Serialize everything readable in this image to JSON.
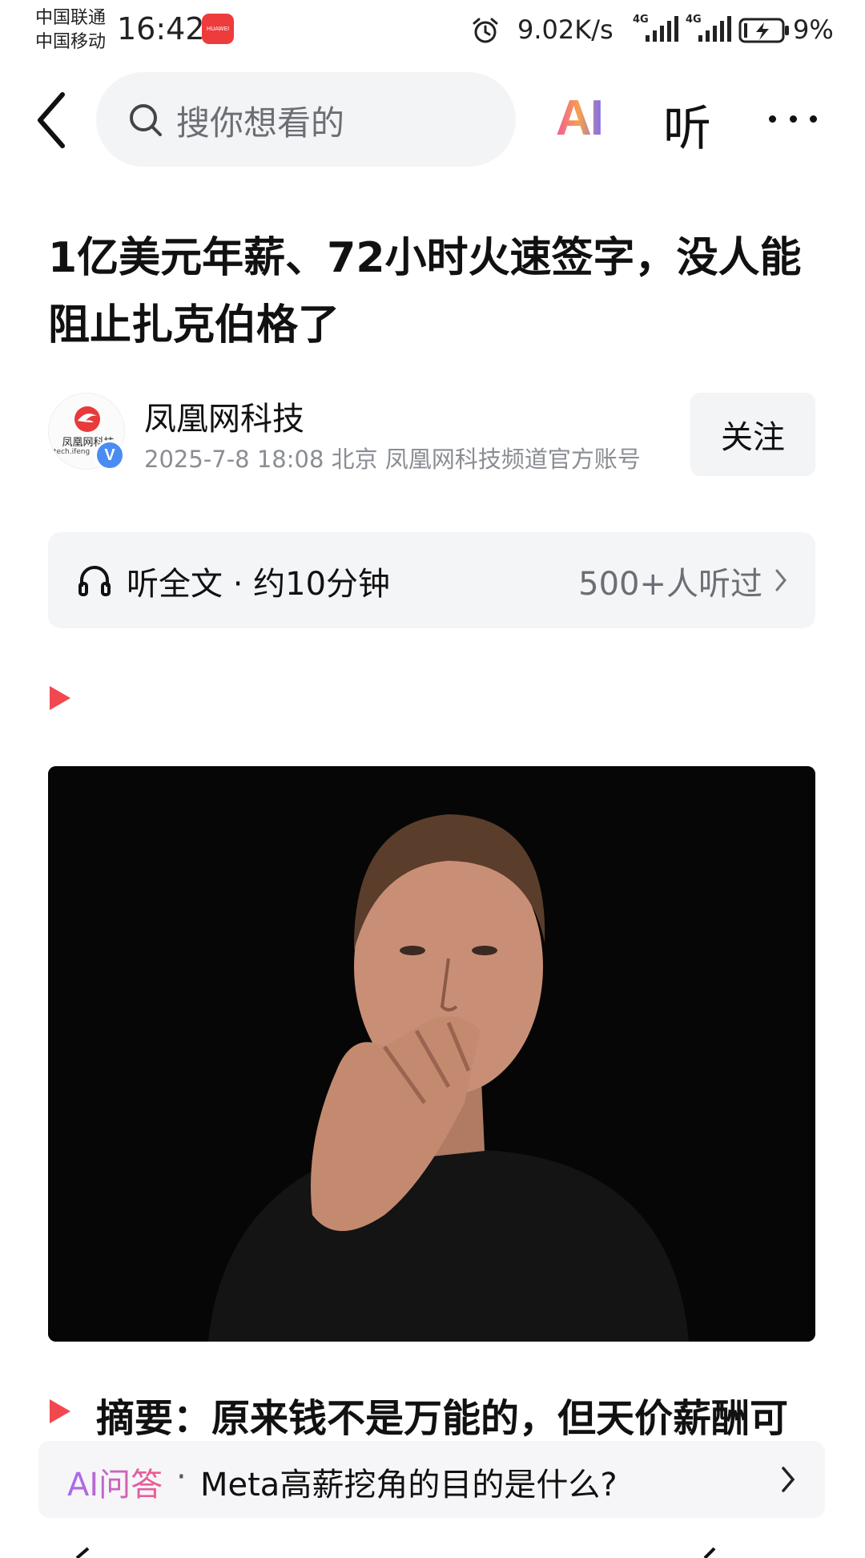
{
  "status_bar": {
    "carrier_1": "中国联通",
    "carrier_2": "中国移动",
    "time": "16:42",
    "app_badge": "HUAWEI",
    "net_speed": "9.02K/s",
    "signal_1_tag": "4G",
    "signal_2_tag": "4G",
    "battery": "9%"
  },
  "nav": {
    "search_placeholder": "搜你想看的",
    "ai_label": "AI",
    "listen_label": "听"
  },
  "article": {
    "title": "1亿美元年薪、72小时火速签字，没人能阻止扎克伯格了",
    "author": {
      "name": "凤凰网科技",
      "logo_text": "凤凰网科技",
      "logo_sub": "tech.ifeng",
      "verified_mark": "V",
      "meta": "2025-7-8  18:08  北京  凤凰网科技频道官方账号"
    },
    "follow_label": "关注"
  },
  "listen_bar": {
    "full_text_label": "听全文 · 约10分钟",
    "listener_count": "500+人听过"
  },
  "summary": {
    "text": "摘要：原来钱不是万能的，但天价薪酬可"
  },
  "ai_qa": {
    "tag": "AI问答",
    "separator": "·",
    "question": "Meta高薪挖角的目的是什么?"
  },
  "colors": {
    "accent_red": "#f0484e",
    "ai_gradient_start": "#f15b9b",
    "ai_gradient_end": "#7b6cf6",
    "verified_blue": "#4a8cf4"
  },
  "icons": [
    "back-icon",
    "search-icon",
    "more-icon",
    "headphones-icon",
    "chevron-right-icon",
    "play-marker-icon",
    "alarm-icon",
    "battery-icon",
    "verified-icon"
  ]
}
